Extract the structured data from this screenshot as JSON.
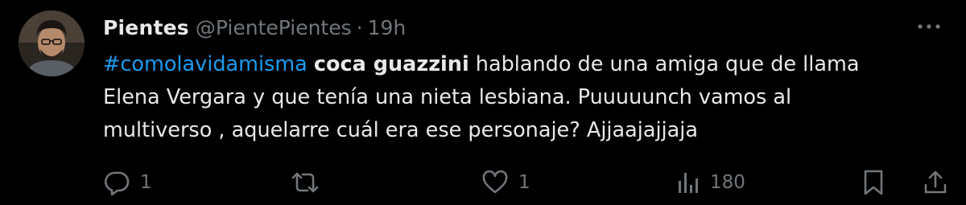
{
  "tweet": {
    "display_name": "Pientes",
    "handle": "@PientePientes",
    "separator": "·",
    "time": "19h",
    "body": {
      "hashtag": "#comolavidamisma",
      "bold_text": "coca guazzini",
      "line1_rest": " hablando de una amiga que de llama",
      "line2": "Elena Vergara y que tenía una nieta lesbiana. Puuuuunch vamos al",
      "line3": "multiverso , aquelarre cuál era ese personaje? Ajjaajajjaja"
    },
    "actions": {
      "reply_count": "1",
      "retweet_count": "",
      "like_count": "1",
      "views_count": "180"
    }
  },
  "icons": {
    "reply": "reply-icon",
    "retweet": "retweet-icon",
    "like": "heart-icon",
    "views": "views-chart-icon",
    "bookmark": "bookmark-icon",
    "share": "share-icon",
    "more": "more-icon"
  },
  "colors": {
    "background": "#000000",
    "text_primary": "#e7e9ea",
    "text_secondary": "#71767b",
    "link": "#1d9bf0"
  }
}
